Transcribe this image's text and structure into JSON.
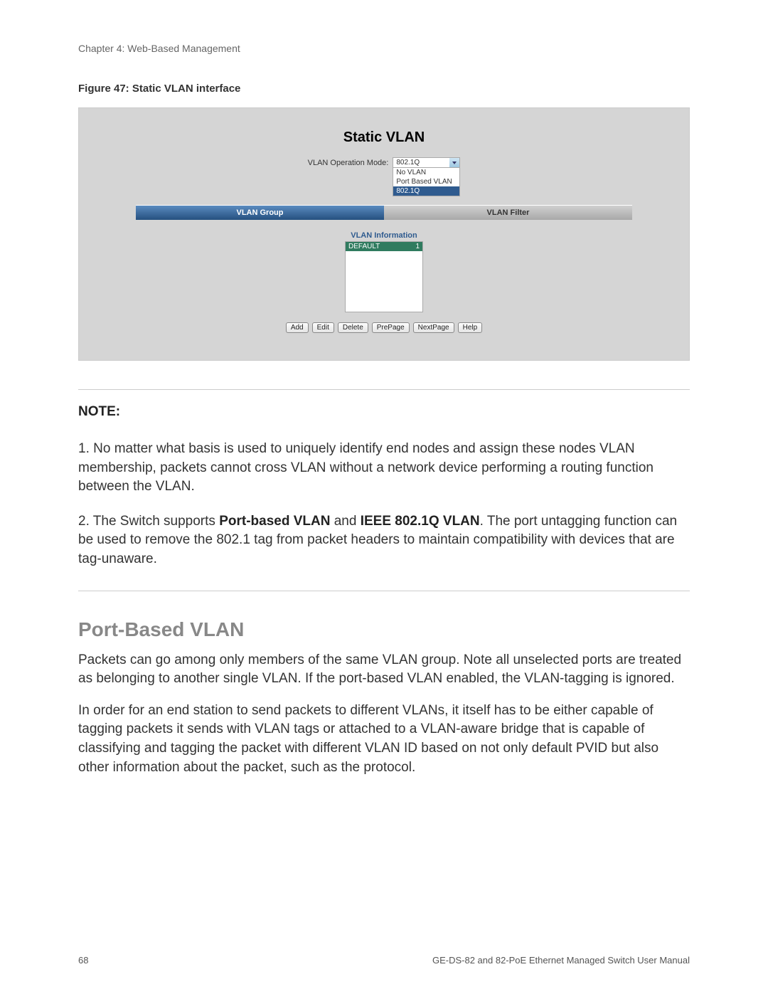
{
  "chapter_header": "Chapter 4: Web-Based Management",
  "figure_caption": "Figure 47:  Static VLAN interface",
  "screenshot": {
    "title": "Static VLAN",
    "mode_label": "VLAN Operation Mode:",
    "dropdown": {
      "selected": "802.1Q",
      "options": [
        "No VLAN",
        "Port Based VLAN",
        "802.1Q"
      ]
    },
    "tabs": {
      "active": "VLAN Group",
      "inactive": "VLAN Filter"
    },
    "info_label": "VLAN Information",
    "list_row": {
      "name": "DEFAULT",
      "id": "1"
    },
    "buttons": [
      "Add",
      "Edit",
      "Delete",
      "PrePage",
      "NextPage",
      "Help"
    ]
  },
  "note": {
    "heading": "NOTE:",
    "para1": "1. No matter what basis is used to uniquely identify end nodes and assign these nodes VLAN membership, packets cannot cross VLAN without a network device performing a routing function between the VLAN.",
    "para2_pre": "2. The Switch supports ",
    "para2_b1": "Port-based VLAN",
    "para2_mid": " and ",
    "para2_b2": "IEEE 802.1Q VLAN",
    "para2_post": ". The port untagging function can be used to remove the 802.1 tag from packet headers to maintain compatibility with devices that are tag-unaware."
  },
  "section": {
    "heading": "Port-Based VLAN",
    "para1": "Packets can go among only members of the same VLAN group. Note all unselected ports are treated as belonging to another single VLAN. If the port-based VLAN enabled, the VLAN-tagging is ignored.",
    "para2": "In order for an end station to send packets to different VLANs, it itself has to be either capable of tagging packets it sends with VLAN tags or attached to a VLAN-aware bridge that is capable of classifying and tagging the packet with different VLAN ID based on not only default PVID but also other information about the packet, such as the protocol."
  },
  "footer": {
    "page": "68",
    "manual": "GE-DS-82 and 82-PoE Ethernet Managed Switch User Manual"
  }
}
